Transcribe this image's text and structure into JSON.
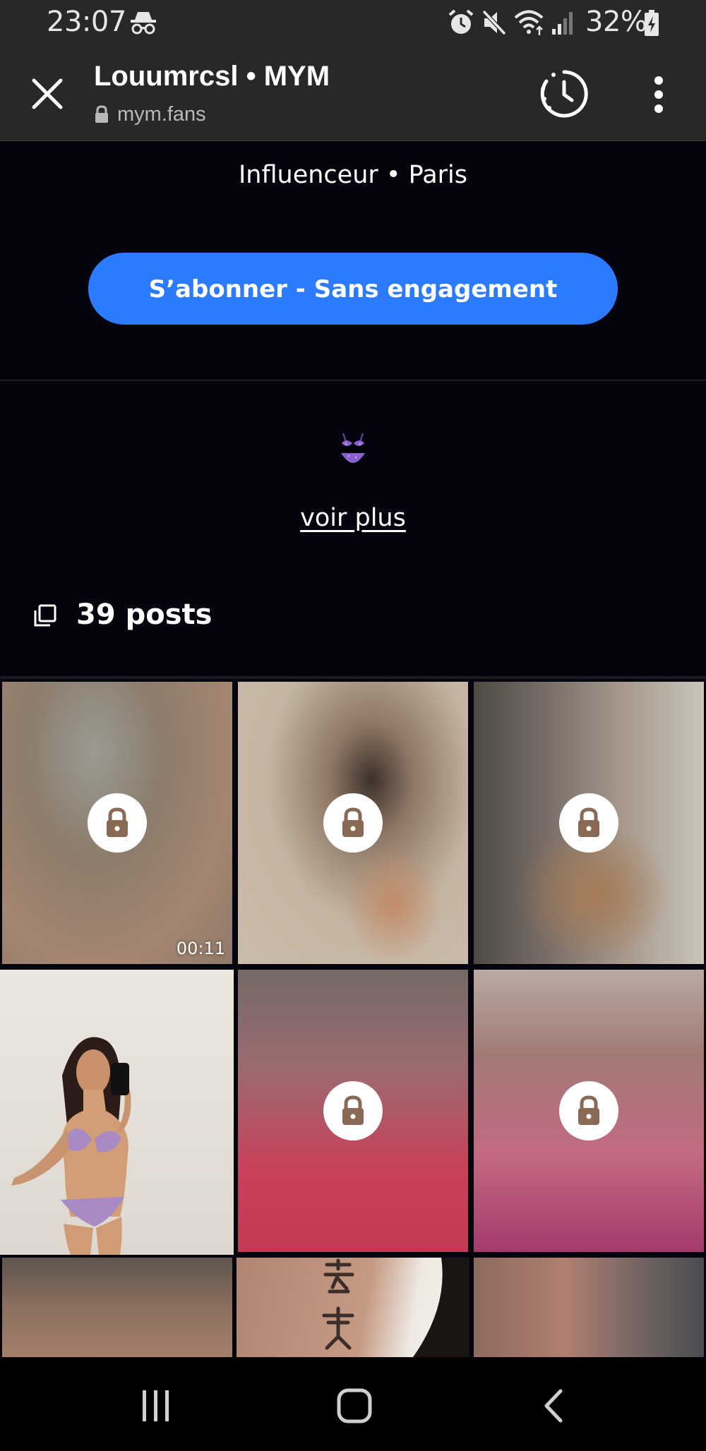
{
  "status_bar": {
    "time": "23:07",
    "battery_percent": "32%",
    "icons": [
      "incognito-icon",
      "alarm-icon",
      "mute-icon",
      "wifi-icon",
      "signal-icon",
      "battery-charging-icon"
    ]
  },
  "browser": {
    "page_title": "Louumrcsl • MYM",
    "url": "mym.fans",
    "icons": [
      "close-icon",
      "lock-icon",
      "history-icon",
      "more-vertical-icon"
    ]
  },
  "profile": {
    "bio": "Influenceur • Paris",
    "subscribe_label": "S’abonner - Sans engagement",
    "emoji": "bikini-emoji",
    "see_more_label": "voir plus",
    "posts_count_label": "39 posts",
    "posts_icon": "copy-icon"
  },
  "grid": {
    "tiles": [
      {
        "locked": true,
        "duration": "00:11"
      },
      {
        "locked": true
      },
      {
        "locked": true
      },
      {
        "locked": false
      },
      {
        "locked": true
      },
      {
        "locked": true
      },
      {
        "locked": true
      },
      {
        "locked": false
      },
      {
        "locked": true
      }
    ]
  },
  "nav_bar": {
    "icons": [
      "recents-icon",
      "home-icon",
      "back-icon"
    ]
  },
  "colors": {
    "accent": "#2c7bff",
    "page_background": "#04040e",
    "toolbar": "#282828",
    "lock_glyph": "#8a6a55"
  }
}
